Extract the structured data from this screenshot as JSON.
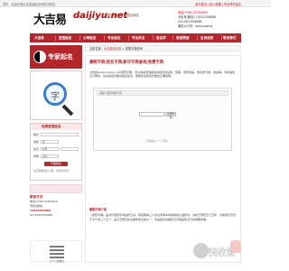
{
  "topbar": {
    "text": "您好，欢迎光临大吉易经起名网官方网站!",
    "links": [
      "设为首页",
      "|",
      "加入收藏",
      "|",
      "专业帮忙起名"
    ]
  },
  "header": {
    "logo_mark": "大吉易",
    "logo_text": "daijiyu.net",
    "slogan": "专业帮忙起名 专业起名网站",
    "info_line1": "电话:0760-23304050",
    "info_line2": "手机号(微信):13622306888",
    "info_line3": "QQ:2622306888",
    "info_line4": "微信公众号：daijiyuwang"
  },
  "nav": {
    "items": [
      "大吉易",
      "宝宝起名",
      "公司起名",
      "专业起名",
      "专业改名",
      "姓名学",
      "周易预测",
      "生肖运势",
      "联系我们"
    ]
  },
  "sidebar": {
    "promo_label": "专家起名",
    "form_title": "免费宝宝起名",
    "form_fields": [
      {
        "label": "姓氏",
        "value": ""
      },
      {
        "label": "性别",
        "value": "男"
      },
      {
        "label": "生日",
        "value": "公历"
      },
      {
        "label": "时辰",
        "value": "子时"
      }
    ],
    "form_button": "开始起名",
    "form_note": "每天限制起名人数，请抓紧时间",
    "contact_title": "联系方式",
    "contact_lines": [
      "电话:0760-23304050",
      "手机(微信):",
      "13622306888",
      "QQ:2622306888"
    ],
    "qr_text": "扫一扫加微信"
  },
  "breadcrumb": {
    "prefix": "当前位置：",
    "home": "大吉易起名网",
    "sep": " > ",
    "current": "康熙字典查询"
  },
  "article": {
    "title": "康熙字典|起名字典|新华字典查询|免费字典",
    "para_intro": "大吉易(www.daijiyu.net)康熙字典，可以快速查询起名常用字的读音、部首、康熙笔画、姓名学分类、吉凶等，同时提供五行属性、生肖喜忌及相关起名建议，帮助您在起名时做出正确选择。",
    "search_bar": "请输入要查询的汉字：",
    "search_button": "立即查询",
    "search_tip": "(只能输入一个汉字)",
    "section2_title": "康熙字典介绍",
    "para2": "《康熙字典》是清代康熙年间由张玉书、陈廷敬等三十多位学者奉命编撰的汉语辞书，书成于康熙五十五年，共收录汉字四万七千零三十五个，是汉字研究的主要参考文献之一，也是起名时确定汉字笔画和五行的重要依据。"
  },
  "watermark": {
    "text": "快收录"
  }
}
